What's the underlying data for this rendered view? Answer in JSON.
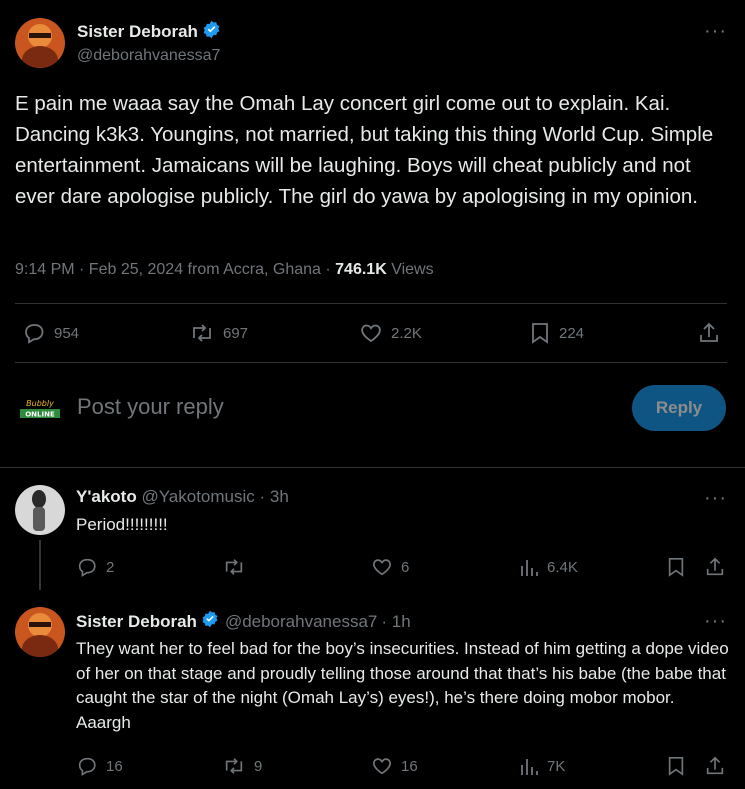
{
  "main_tweet": {
    "author_name": "Sister Deborah",
    "handle": "@deborahvanessa7",
    "text": "E pain me waaa say the Omah Lay concert girl come out to explain. Kai. Dancing k3k3. Youngins, not married, but taking this thing World Cup. Simple entertainment. Jamaicans will be laughing. Boys will cheat publicly and not ever dare apologise publicly. The girl do yawa by apologising in my opinion.",
    "meta_prefix": "9:14 PM · Feb 25, 2024 from Accra, Ghana · ",
    "views_count": "746.1K",
    "views_label": " Views",
    "stats": {
      "replies": "954",
      "reposts": "697",
      "likes": "2.2K",
      "bookmarks": "224"
    }
  },
  "reply_box": {
    "placeholder": "Post your reply",
    "button_label": "Reply",
    "logo_text_top": "Bubbly",
    "logo_text_bottom": "ONLINE"
  },
  "replies": [
    {
      "author_name": "Y'akoto",
      "handle": "@Yakotomusic",
      "time": "· 3h",
      "text": "Period!!!!!!!!!",
      "stats": {
        "replies": "2",
        "reposts": "",
        "likes": "6",
        "views": "6.4K"
      }
    },
    {
      "author_name": "Sister Deborah",
      "handle": "@deborahvanessa7",
      "time": "· 1h",
      "text": "They want her to feel bad for the boy’s insecurities. Instead of him getting a dope video of her on that stage and proudly telling those around that that’s his babe (the babe that caught the star of the night  (Omah Lay’s) eyes!), he’s there doing mobor mobor. Aaargh",
      "stats": {
        "replies": "16",
        "reposts": "9",
        "likes": "16",
        "views": "7K"
      }
    }
  ],
  "colors": {
    "background": "#000000",
    "text": "#e7e9ea",
    "muted": "#71767b",
    "accent": "#1d9bf0",
    "divider": "#2f3336"
  }
}
